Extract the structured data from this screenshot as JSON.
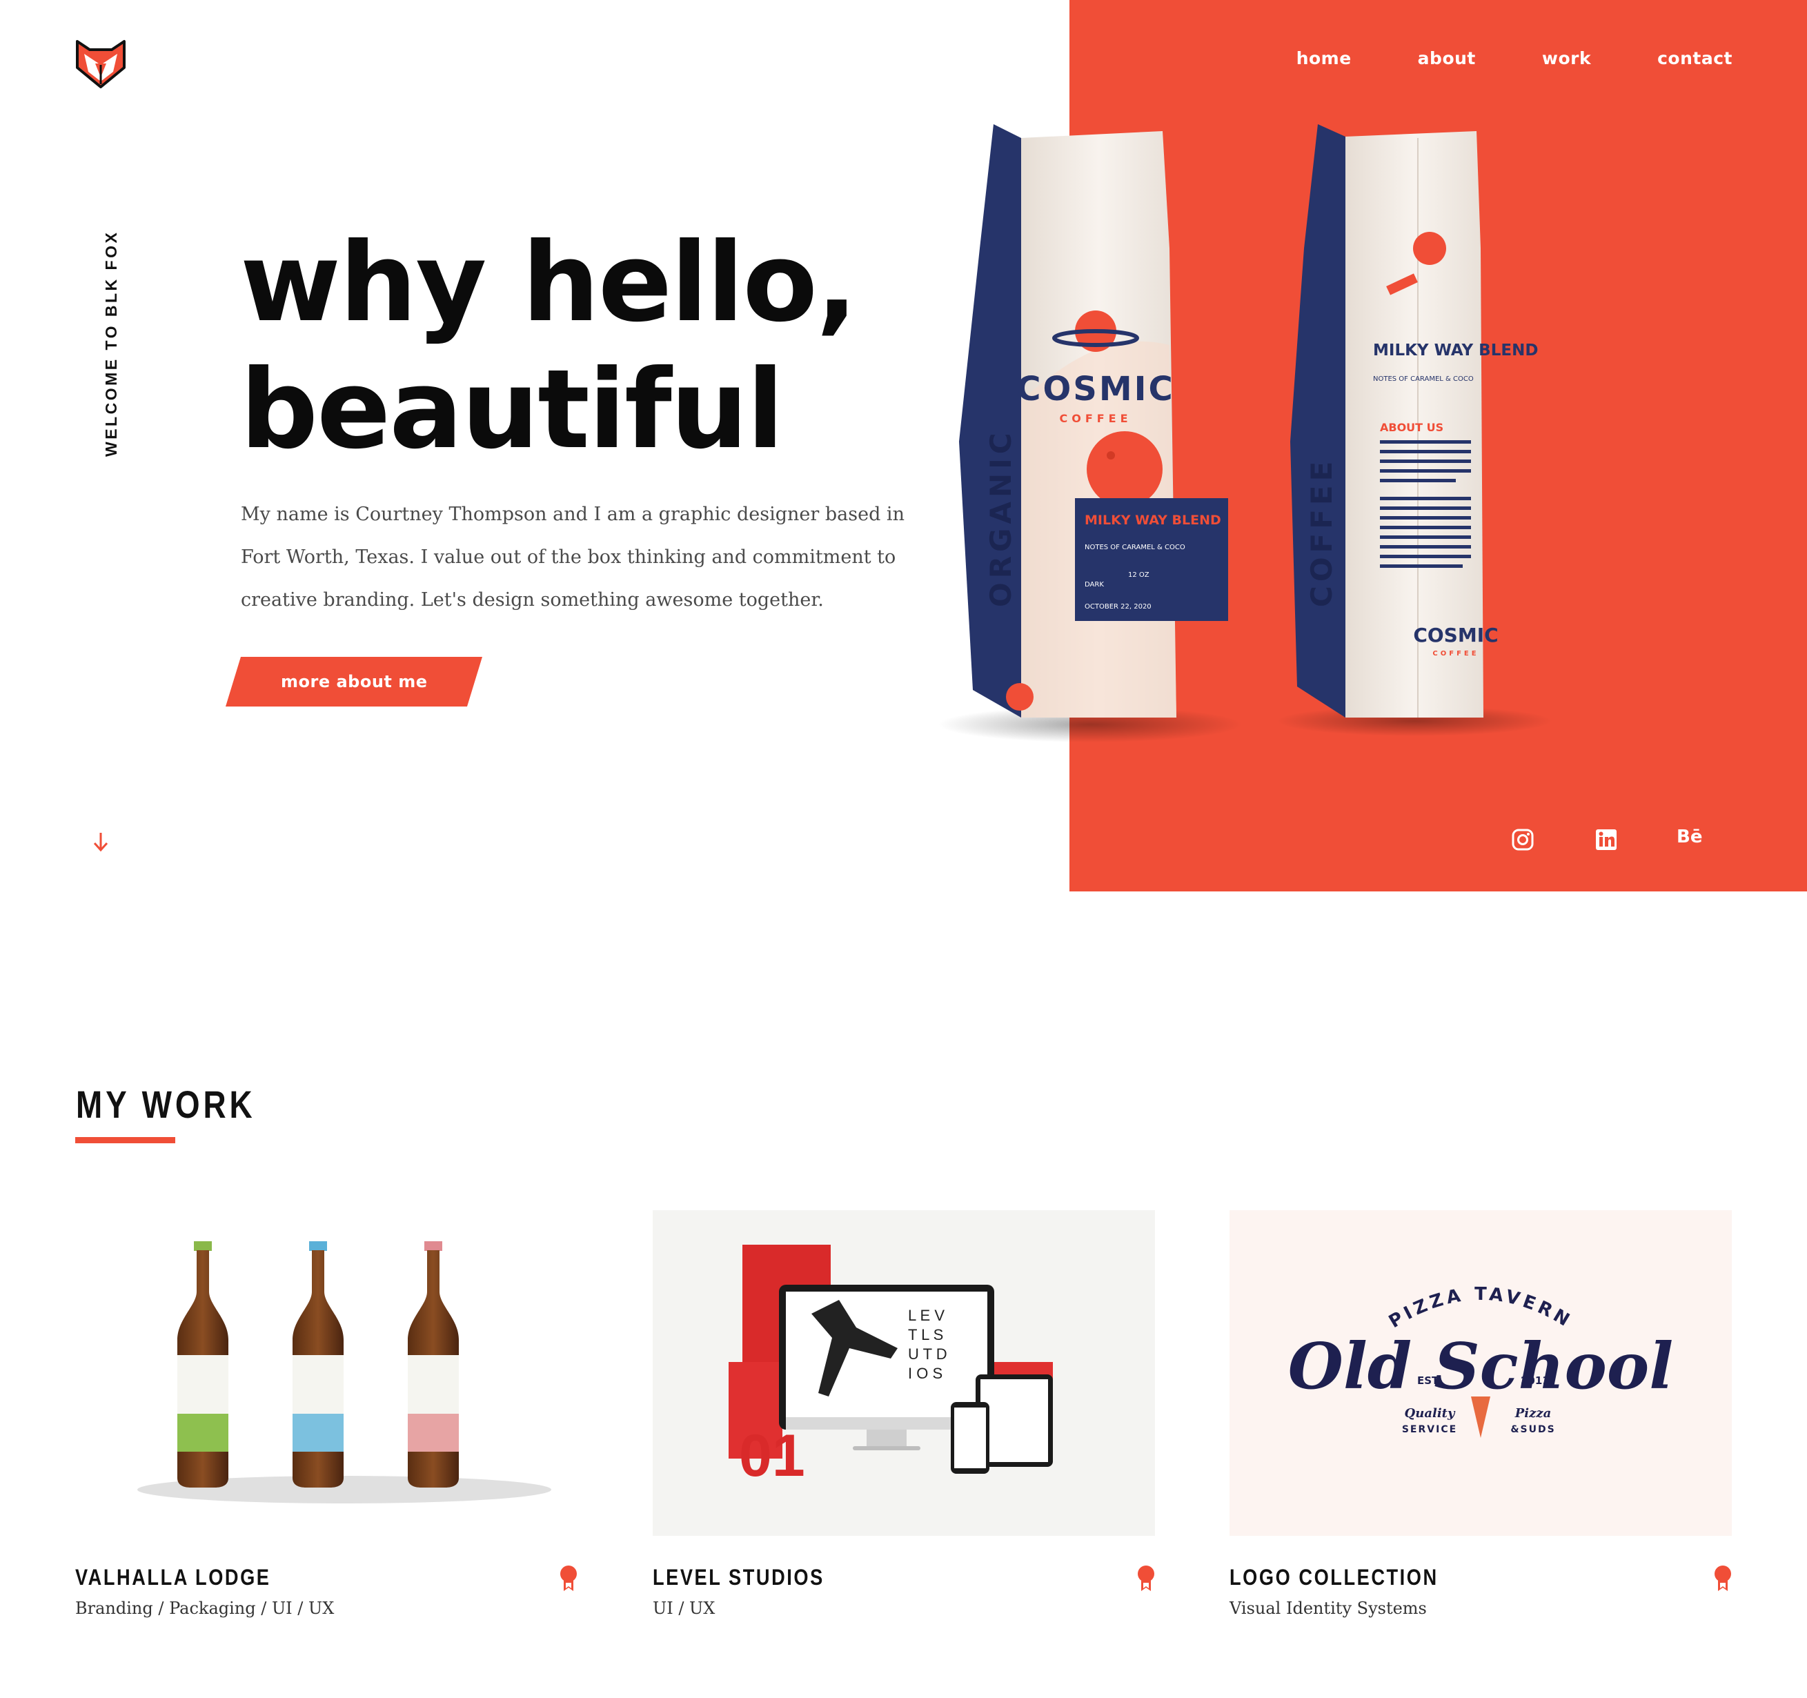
{
  "nav": {
    "items": [
      "home",
      "about",
      "work",
      "contact"
    ]
  },
  "hero": {
    "side_tag": "WELCOME TO BLK FOX",
    "title_line1": "why hello,",
    "title_line2": "beautiful",
    "intro": "My name is Courtney Thompson and I am a graphic designer based in Fort Worth, Texas. I value out of the box thinking and commitment to creative branding. Let's design something awesome together.",
    "cta_label": "more about me"
  },
  "bags": {
    "front_brand": "COSMIC",
    "front_sub": "COFFEE",
    "front_side": "ORGANIC",
    "front_blend": "MILKY WAY BLEND",
    "front_notes": "NOTES OF CARAMEL & COCO",
    "front_roast": "DARK",
    "front_weight": "12 OZ",
    "front_date": "OCTOBER 22, 2020",
    "back_title": "MILKY WAY BLEND",
    "back_notes": "NOTES OF CARAMEL & COCO",
    "back_about": "ABOUT US",
    "back_side": "COFFEE",
    "back_brand": "COSMIC",
    "back_sub": "COFFEE"
  },
  "social": [
    "instagram-icon",
    "linkedin-icon",
    "behance-icon"
  ],
  "work": {
    "heading": "MY WORK",
    "cards": [
      {
        "title": "VALHALLA LODGE",
        "subtitle": "Branding / Packaging / UI / UX"
      },
      {
        "title": "LEVEL STUDIOS",
        "subtitle": "UI / UX",
        "number": "01"
      },
      {
        "title": "LOGO COLLECTION",
        "subtitle": "Visual Identity Systems"
      }
    ],
    "logo": {
      "arc": "PIZZA TAVERN",
      "script": "Old School",
      "est": "EST",
      "year": "2011",
      "left": "Quality",
      "left2": "SERVICE",
      "right": "Pizza",
      "right2": "&SUDS"
    }
  },
  "colors": {
    "accent": "#f04e37",
    "navy": "#1e2a5a",
    "text": "#0d0d0d"
  }
}
